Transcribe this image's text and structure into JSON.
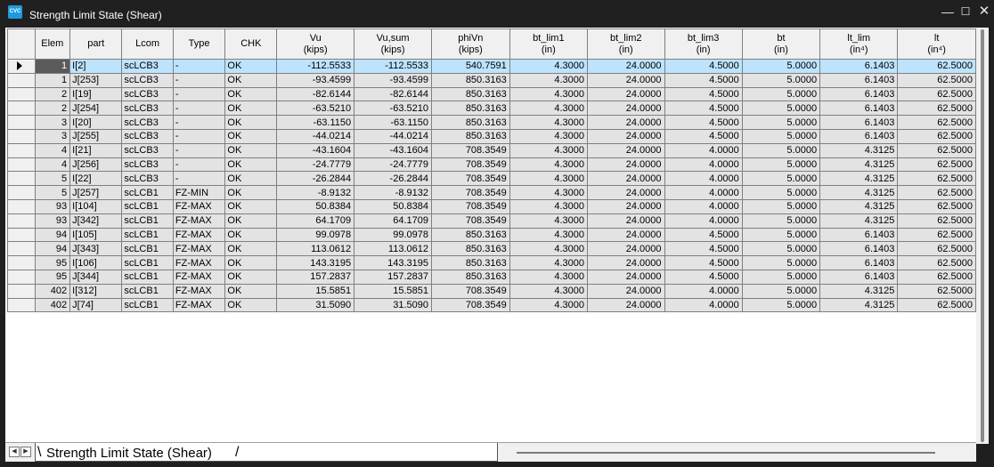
{
  "window": {
    "icon_text": "CVC",
    "title": "Strength Limit State (Shear)",
    "minimize": "—",
    "maximize": "☐",
    "close": "✕"
  },
  "columns": [
    {
      "key": "elem",
      "label": "Elem"
    },
    {
      "key": "part",
      "label": "part"
    },
    {
      "key": "lcom",
      "label": "Lcom"
    },
    {
      "key": "type",
      "label": "Type"
    },
    {
      "key": "chk",
      "label": "CHK"
    },
    {
      "key": "vu",
      "label": "Vu\n(kips)"
    },
    {
      "key": "vusum",
      "label": "Vu,sum\n(kips)"
    },
    {
      "key": "phivn",
      "label": "phiVn\n(kips)"
    },
    {
      "key": "bt_lim1",
      "label": "bt_lim1\n(in)"
    },
    {
      "key": "bt_lim2",
      "label": "bt_lim2\n(in)"
    },
    {
      "key": "bt_lim3",
      "label": "bt_lim3\n(in)"
    },
    {
      "key": "bt",
      "label": "bt\n(in)"
    },
    {
      "key": "lt_lim",
      "label": "lt_lim\n(in⁴)"
    },
    {
      "key": "lt",
      "label": "lt\n(in⁴)"
    }
  ],
  "rows": [
    [
      "1",
      "I[2]",
      "scLCB3",
      "-",
      "OK",
      "-112.5533",
      "-112.5533",
      "540.7591",
      "4.3000",
      "24.0000",
      "4.5000",
      "5.0000",
      "6.1403",
      "62.5000"
    ],
    [
      "1",
      "J[253]",
      "scLCB3",
      "-",
      "OK",
      "-93.4599",
      "-93.4599",
      "850.3163",
      "4.3000",
      "24.0000",
      "4.5000",
      "5.0000",
      "6.1403",
      "62.5000"
    ],
    [
      "2",
      "I[19]",
      "scLCB3",
      "-",
      "OK",
      "-82.6144",
      "-82.6144",
      "850.3163",
      "4.3000",
      "24.0000",
      "4.5000",
      "5.0000",
      "6.1403",
      "62.5000"
    ],
    [
      "2",
      "J[254]",
      "scLCB3",
      "-",
      "OK",
      "-63.5210",
      "-63.5210",
      "850.3163",
      "4.3000",
      "24.0000",
      "4.5000",
      "5.0000",
      "6.1403",
      "62.5000"
    ],
    [
      "3",
      "I[20]",
      "scLCB3",
      "-",
      "OK",
      "-63.1150",
      "-63.1150",
      "850.3163",
      "4.3000",
      "24.0000",
      "4.5000",
      "5.0000",
      "6.1403",
      "62.5000"
    ],
    [
      "3",
      "J[255]",
      "scLCB3",
      "-",
      "OK",
      "-44.0214",
      "-44.0214",
      "850.3163",
      "4.3000",
      "24.0000",
      "4.5000",
      "5.0000",
      "6.1403",
      "62.5000"
    ],
    [
      "4",
      "I[21]",
      "scLCB3",
      "-",
      "OK",
      "-43.1604",
      "-43.1604",
      "708.3549",
      "4.3000",
      "24.0000",
      "4.0000",
      "5.0000",
      "4.3125",
      "62.5000"
    ],
    [
      "4",
      "J[256]",
      "scLCB3",
      "-",
      "OK",
      "-24.7779",
      "-24.7779",
      "708.3549",
      "4.3000",
      "24.0000",
      "4.0000",
      "5.0000",
      "4.3125",
      "62.5000"
    ],
    [
      "5",
      "I[22]",
      "scLCB3",
      "-",
      "OK",
      "-26.2844",
      "-26.2844",
      "708.3549",
      "4.3000",
      "24.0000",
      "4.0000",
      "5.0000",
      "4.3125",
      "62.5000"
    ],
    [
      "5",
      "J[257]",
      "scLCB1",
      "FZ-MIN",
      "OK",
      "-8.9132",
      "-8.9132",
      "708.3549",
      "4.3000",
      "24.0000",
      "4.0000",
      "5.0000",
      "4.3125",
      "62.5000"
    ],
    [
      "93",
      "I[104]",
      "scLCB1",
      "FZ-MAX",
      "OK",
      "50.8384",
      "50.8384",
      "708.3549",
      "4.3000",
      "24.0000",
      "4.0000",
      "5.0000",
      "4.3125",
      "62.5000"
    ],
    [
      "93",
      "J[342]",
      "scLCB1",
      "FZ-MAX",
      "OK",
      "64.1709",
      "64.1709",
      "708.3549",
      "4.3000",
      "24.0000",
      "4.0000",
      "5.0000",
      "4.3125",
      "62.5000"
    ],
    [
      "94",
      "I[105]",
      "scLCB1",
      "FZ-MAX",
      "OK",
      "99.0978",
      "99.0978",
      "850.3163",
      "4.3000",
      "24.0000",
      "4.5000",
      "5.0000",
      "6.1403",
      "62.5000"
    ],
    [
      "94",
      "J[343]",
      "scLCB1",
      "FZ-MAX",
      "OK",
      "113.0612",
      "113.0612",
      "850.3163",
      "4.3000",
      "24.0000",
      "4.5000",
      "5.0000",
      "6.1403",
      "62.5000"
    ],
    [
      "95",
      "I[106]",
      "scLCB1",
      "FZ-MAX",
      "OK",
      "143.3195",
      "143.3195",
      "850.3163",
      "4.3000",
      "24.0000",
      "4.5000",
      "5.0000",
      "6.1403",
      "62.5000"
    ],
    [
      "95",
      "J[344]",
      "scLCB1",
      "FZ-MAX",
      "OK",
      "157.2837",
      "157.2837",
      "850.3163",
      "4.3000",
      "24.0000",
      "4.5000",
      "5.0000",
      "6.1403",
      "62.5000"
    ],
    [
      "402",
      "I[312]",
      "scLCB1",
      "FZ-MAX",
      "OK",
      "15.5851",
      "15.5851",
      "708.3549",
      "4.3000",
      "24.0000",
      "4.0000",
      "5.0000",
      "4.3125",
      "62.5000"
    ],
    [
      "402",
      "J[74]",
      "scLCB1",
      "FZ-MAX",
      "OK",
      "31.5090",
      "31.5090",
      "708.3549",
      "4.3000",
      "24.0000",
      "4.0000",
      "5.0000",
      "4.3125",
      "62.5000"
    ]
  ],
  "selected_row": 0,
  "sheet_tab": {
    "label": "Strength Limit State (Shear)",
    "nav_prev": "◀",
    "nav_next": "▶"
  }
}
